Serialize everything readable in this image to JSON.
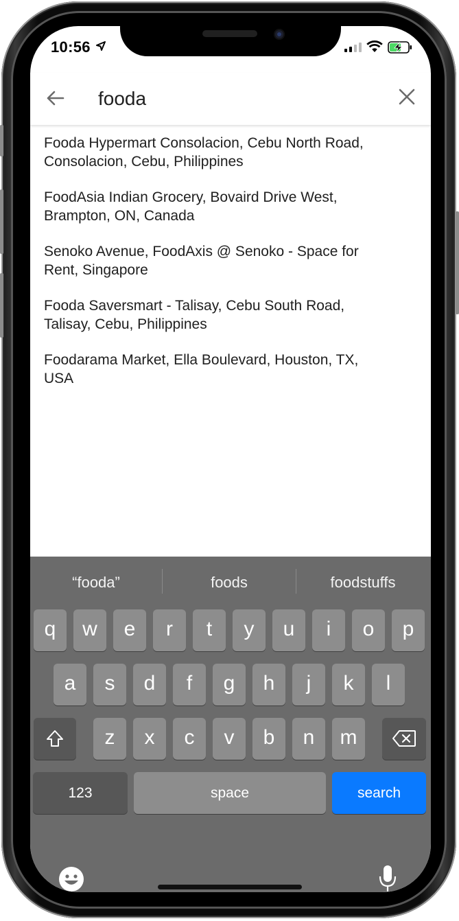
{
  "status_bar": {
    "time": "10:56"
  },
  "search": {
    "query": "fooda"
  },
  "results": [
    {
      "line1": "Fooda Hypermart Consolacion, Cebu North Road,",
      "line2": "Consolacion, Cebu, Philippines"
    },
    {
      "line1": "FoodAsia Indian Grocery, Bovaird Drive West,",
      "line2": "Brampton, ON, Canada"
    },
    {
      "line1": "Senoko Avenue, FoodAxis @ Senoko - Space for",
      "line2": "Rent, Singapore"
    },
    {
      "line1": "Fooda Saversmart - Talisay, Cebu South Road,",
      "line2": "Talisay, Cebu, Philippines"
    },
    {
      "line1": "Foodarama Market, Ella Boulevard, Houston, TX,",
      "line2": "USA"
    }
  ],
  "keyboard": {
    "suggestions": [
      "“fooda”",
      "foods",
      "foodstuffs"
    ],
    "row1": [
      "q",
      "w",
      "e",
      "r",
      "t",
      "y",
      "u",
      "i",
      "o",
      "p"
    ],
    "row2": [
      "a",
      "s",
      "d",
      "f",
      "g",
      "h",
      "j",
      "k",
      "l"
    ],
    "row3": [
      "z",
      "x",
      "c",
      "v",
      "b",
      "n",
      "m"
    ],
    "numbers_label": "123",
    "space_label": "space",
    "search_label": "search"
  },
  "colors": {
    "search_key": "#0a7aff",
    "keyboard_bg": "#6b6b6b"
  }
}
